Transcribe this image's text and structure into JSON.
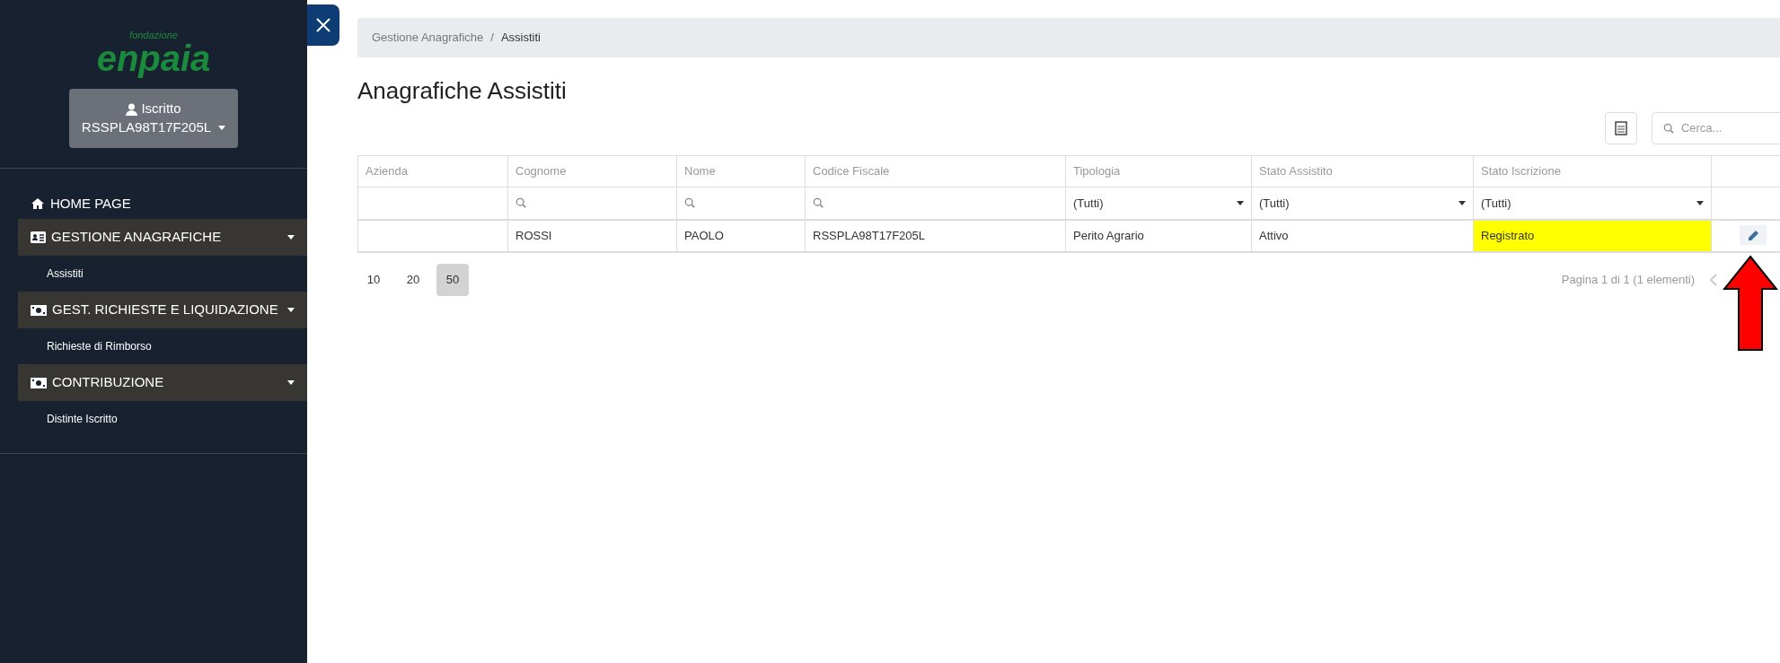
{
  "sidebar": {
    "logo": {
      "small": "fondazione",
      "large": "enpaia"
    },
    "user_button": {
      "role": "Iscritto",
      "code": "RSSPLA98T17F205L"
    },
    "menu": [
      {
        "kind": "link",
        "label": "HOME PAGE"
      },
      {
        "kind": "section",
        "label": "GESTIONE ANAGRAFICHE",
        "children": [
          {
            "label": "Assistiti"
          }
        ]
      },
      {
        "kind": "section",
        "label": "GEST. RICHIESTE E LIQUIDAZIONE",
        "children": [
          {
            "label": "Richieste di Rimborso"
          }
        ]
      },
      {
        "kind": "section",
        "label": "CONTRIBUZIONE",
        "children": [
          {
            "label": "Distinte Iscritto"
          }
        ]
      }
    ]
  },
  "breadcrumb": {
    "items": [
      "Gestione Anagrafiche",
      "Assistiti"
    ],
    "separator": "/"
  },
  "title": "Anagrafiche Assistiti",
  "search": {
    "placeholder": "Cerca..."
  },
  "table": {
    "columns": [
      {
        "label": "Azienda"
      },
      {
        "label": "Cognome"
      },
      {
        "label": "Nome"
      },
      {
        "label": "Codice Fiscale"
      },
      {
        "label": "Tipologia"
      },
      {
        "label": "Stato Assistito"
      },
      {
        "label": "Stato Iscrizione"
      },
      {}
    ],
    "filters": [
      {
        "kind": "none"
      },
      {
        "kind": "search"
      },
      {
        "kind": "search"
      },
      {
        "kind": "search"
      },
      {
        "kind": "select",
        "value": "(Tutti)"
      },
      {
        "kind": "select",
        "value": "(Tutti)"
      },
      {
        "kind": "select",
        "value": "(Tutti)"
      },
      {
        "kind": "none"
      }
    ],
    "rows": [
      {
        "cells": [
          {
            "kind": "empty"
          },
          {
            "kind": "text",
            "text": "ROSSI"
          },
          {
            "kind": "text",
            "text": "PAOLO"
          },
          {
            "kind": "text",
            "text": "RSSPLA98T17F205L"
          },
          {
            "kind": "text",
            "text": "Perito Agrario"
          },
          {
            "kind": "text",
            "text": "Attivo"
          },
          {
            "kind": "text",
            "text": "Registrato",
            "color": "#ffff00"
          },
          {
            "kind": "action"
          }
        ]
      }
    ]
  },
  "page_sizes": [
    {
      "label": "10",
      "selected": false
    },
    {
      "label": "20",
      "selected": false
    },
    {
      "label": "50",
      "selected": true
    }
  ],
  "pager": {
    "info": "Pagina 1 di 1 (1 elementi)"
  }
}
